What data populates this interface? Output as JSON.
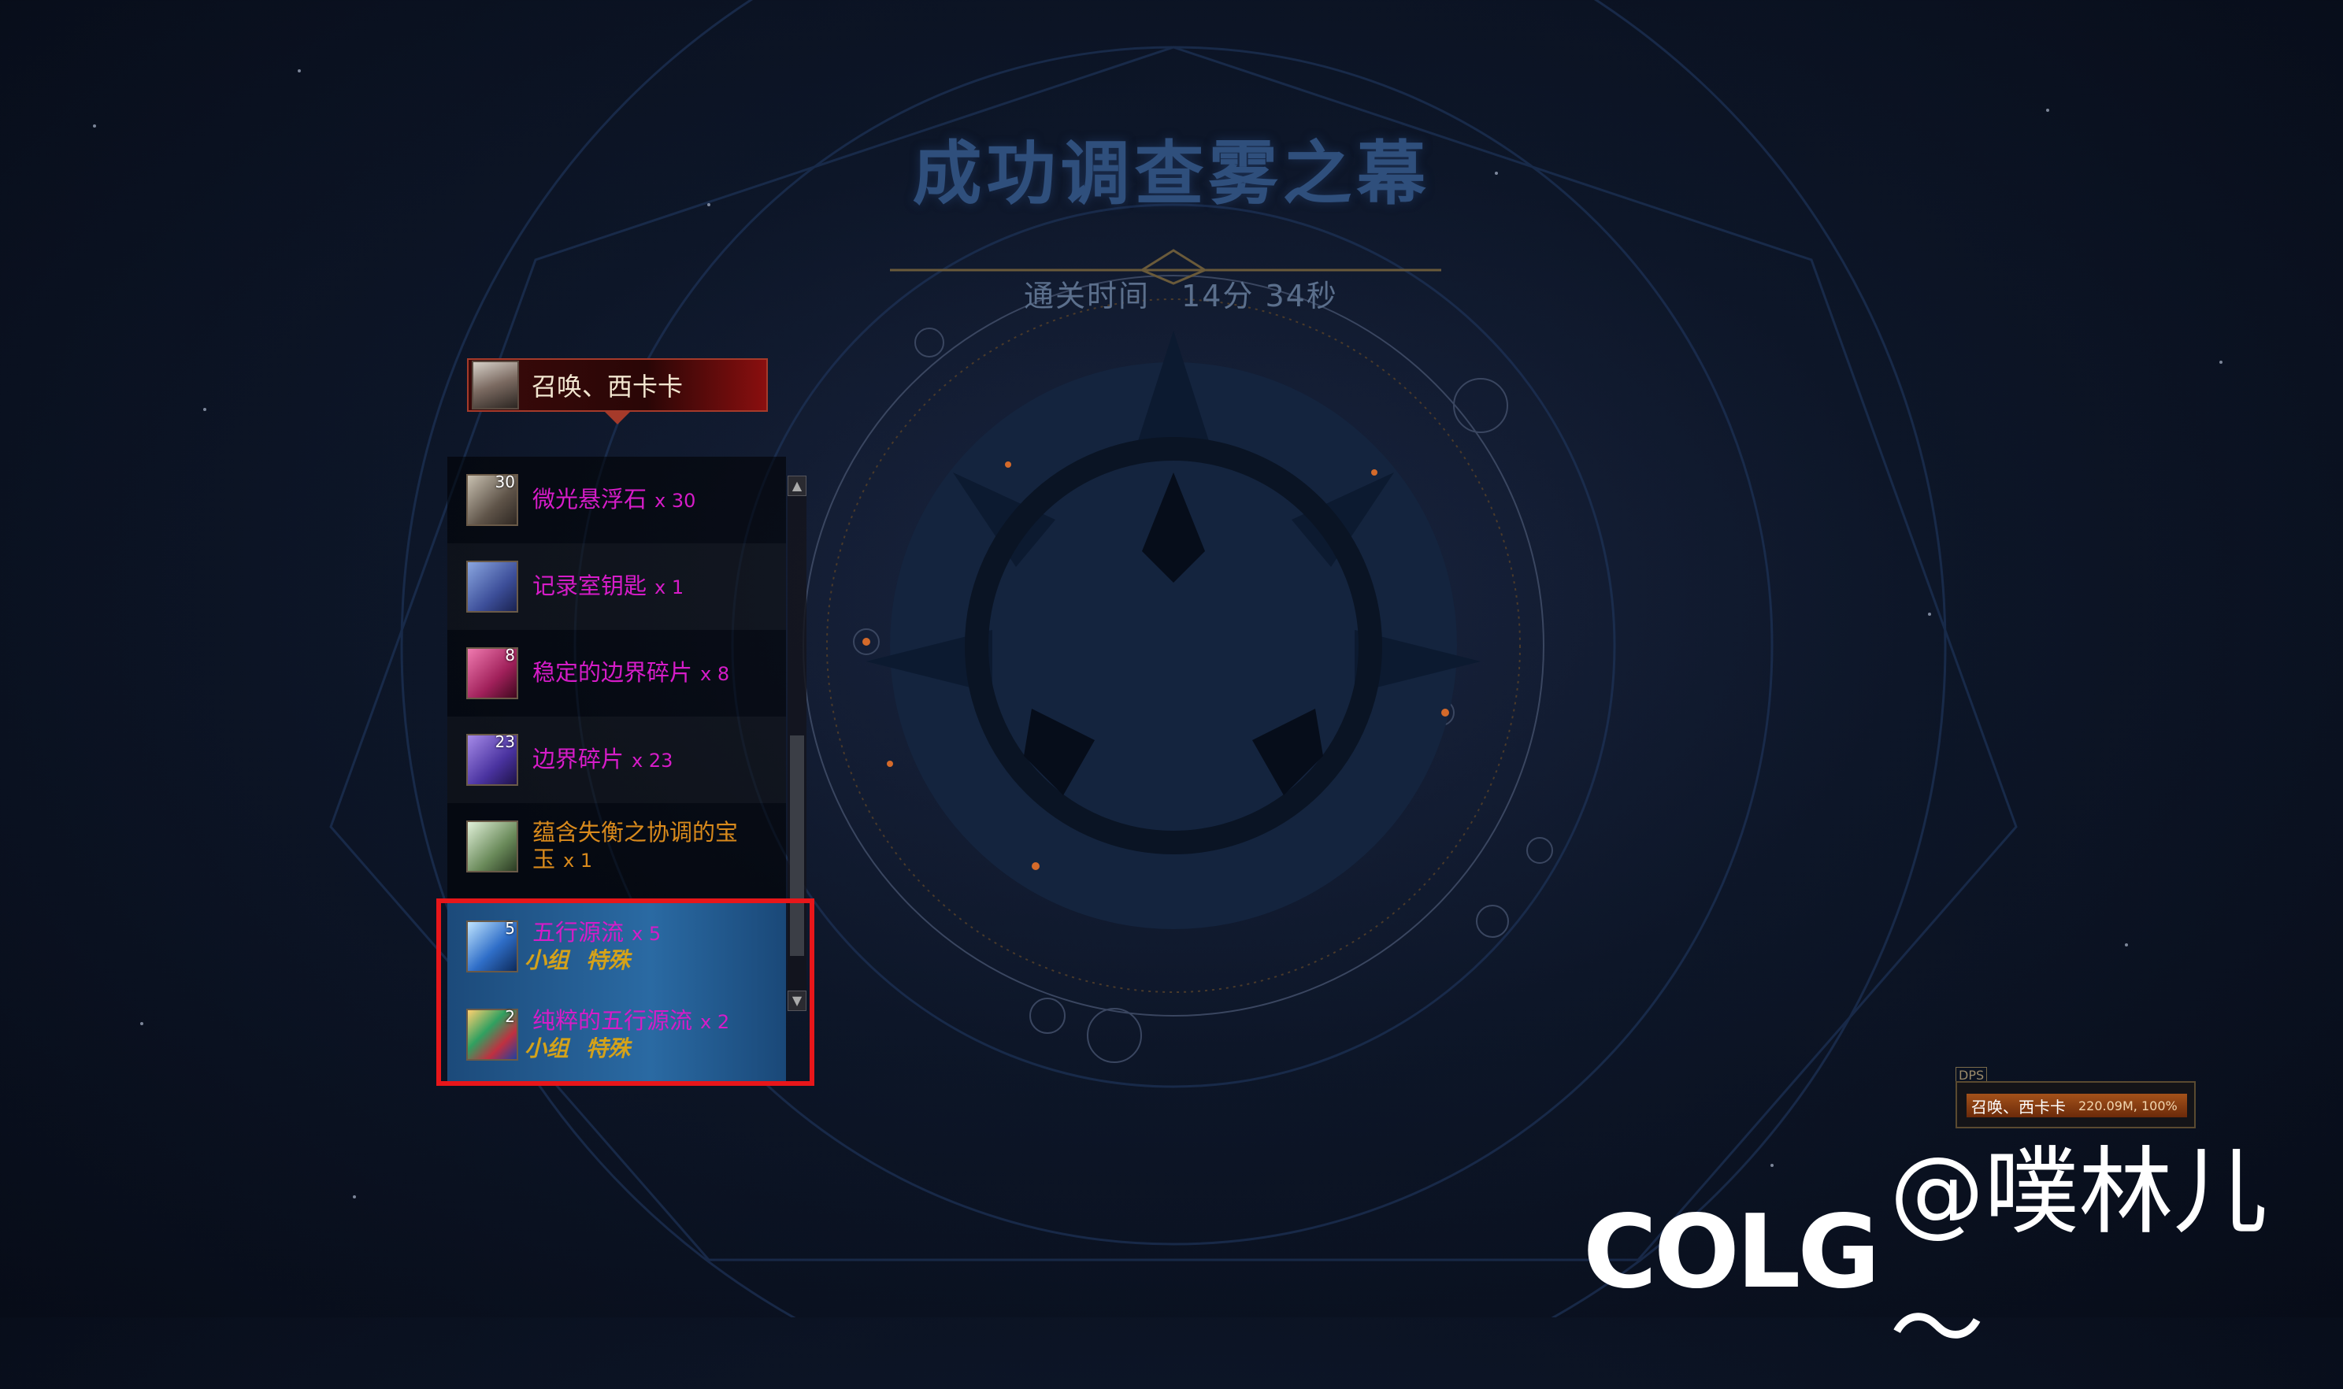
{
  "title": "成功调查雾之幕",
  "clear_time": {
    "label": "通关时间",
    "value": "14分 34秒"
  },
  "character": {
    "name": "召唤、西卡卡"
  },
  "loot": [
    {
      "name": "微光悬浮石",
      "qty": "x 30",
      "count": "30",
      "color": "#d61cc8"
    },
    {
      "name": "记录室钥匙",
      "qty": "x 1",
      "count": "",
      "color": "#d61cc8"
    },
    {
      "name": "稳定的边界碎片",
      "qty": "x 8",
      "count": "8",
      "color": "#d61cc8"
    },
    {
      "name": "边界碎片",
      "qty": "x 23",
      "count": "23",
      "color": "#d61cc8"
    },
    {
      "name_line1": "蕴含失衡之协调的宝",
      "name_line2": "玉",
      "qty": "x 1",
      "count": "",
      "color": "#d98a1c"
    },
    {
      "name": "五行源流",
      "qty": "x 5",
      "count": "5",
      "tags": [
        "小组",
        "特殊"
      ],
      "color": "#d61cc8"
    },
    {
      "name": "纯粹的五行源流",
      "qty": "x 2",
      "count": "2",
      "tags": [
        "小组",
        "特殊"
      ],
      "color": "#d61cc8"
    }
  ],
  "dps": {
    "label": "DPS",
    "name": "召唤、西卡卡",
    "value": "220.09M, 100%"
  },
  "watermark": {
    "logo": "COLG",
    "user": "@噗林儿～"
  },
  "colors": {
    "highlight_border": "#e8161a",
    "title": "#2f4f7c"
  }
}
